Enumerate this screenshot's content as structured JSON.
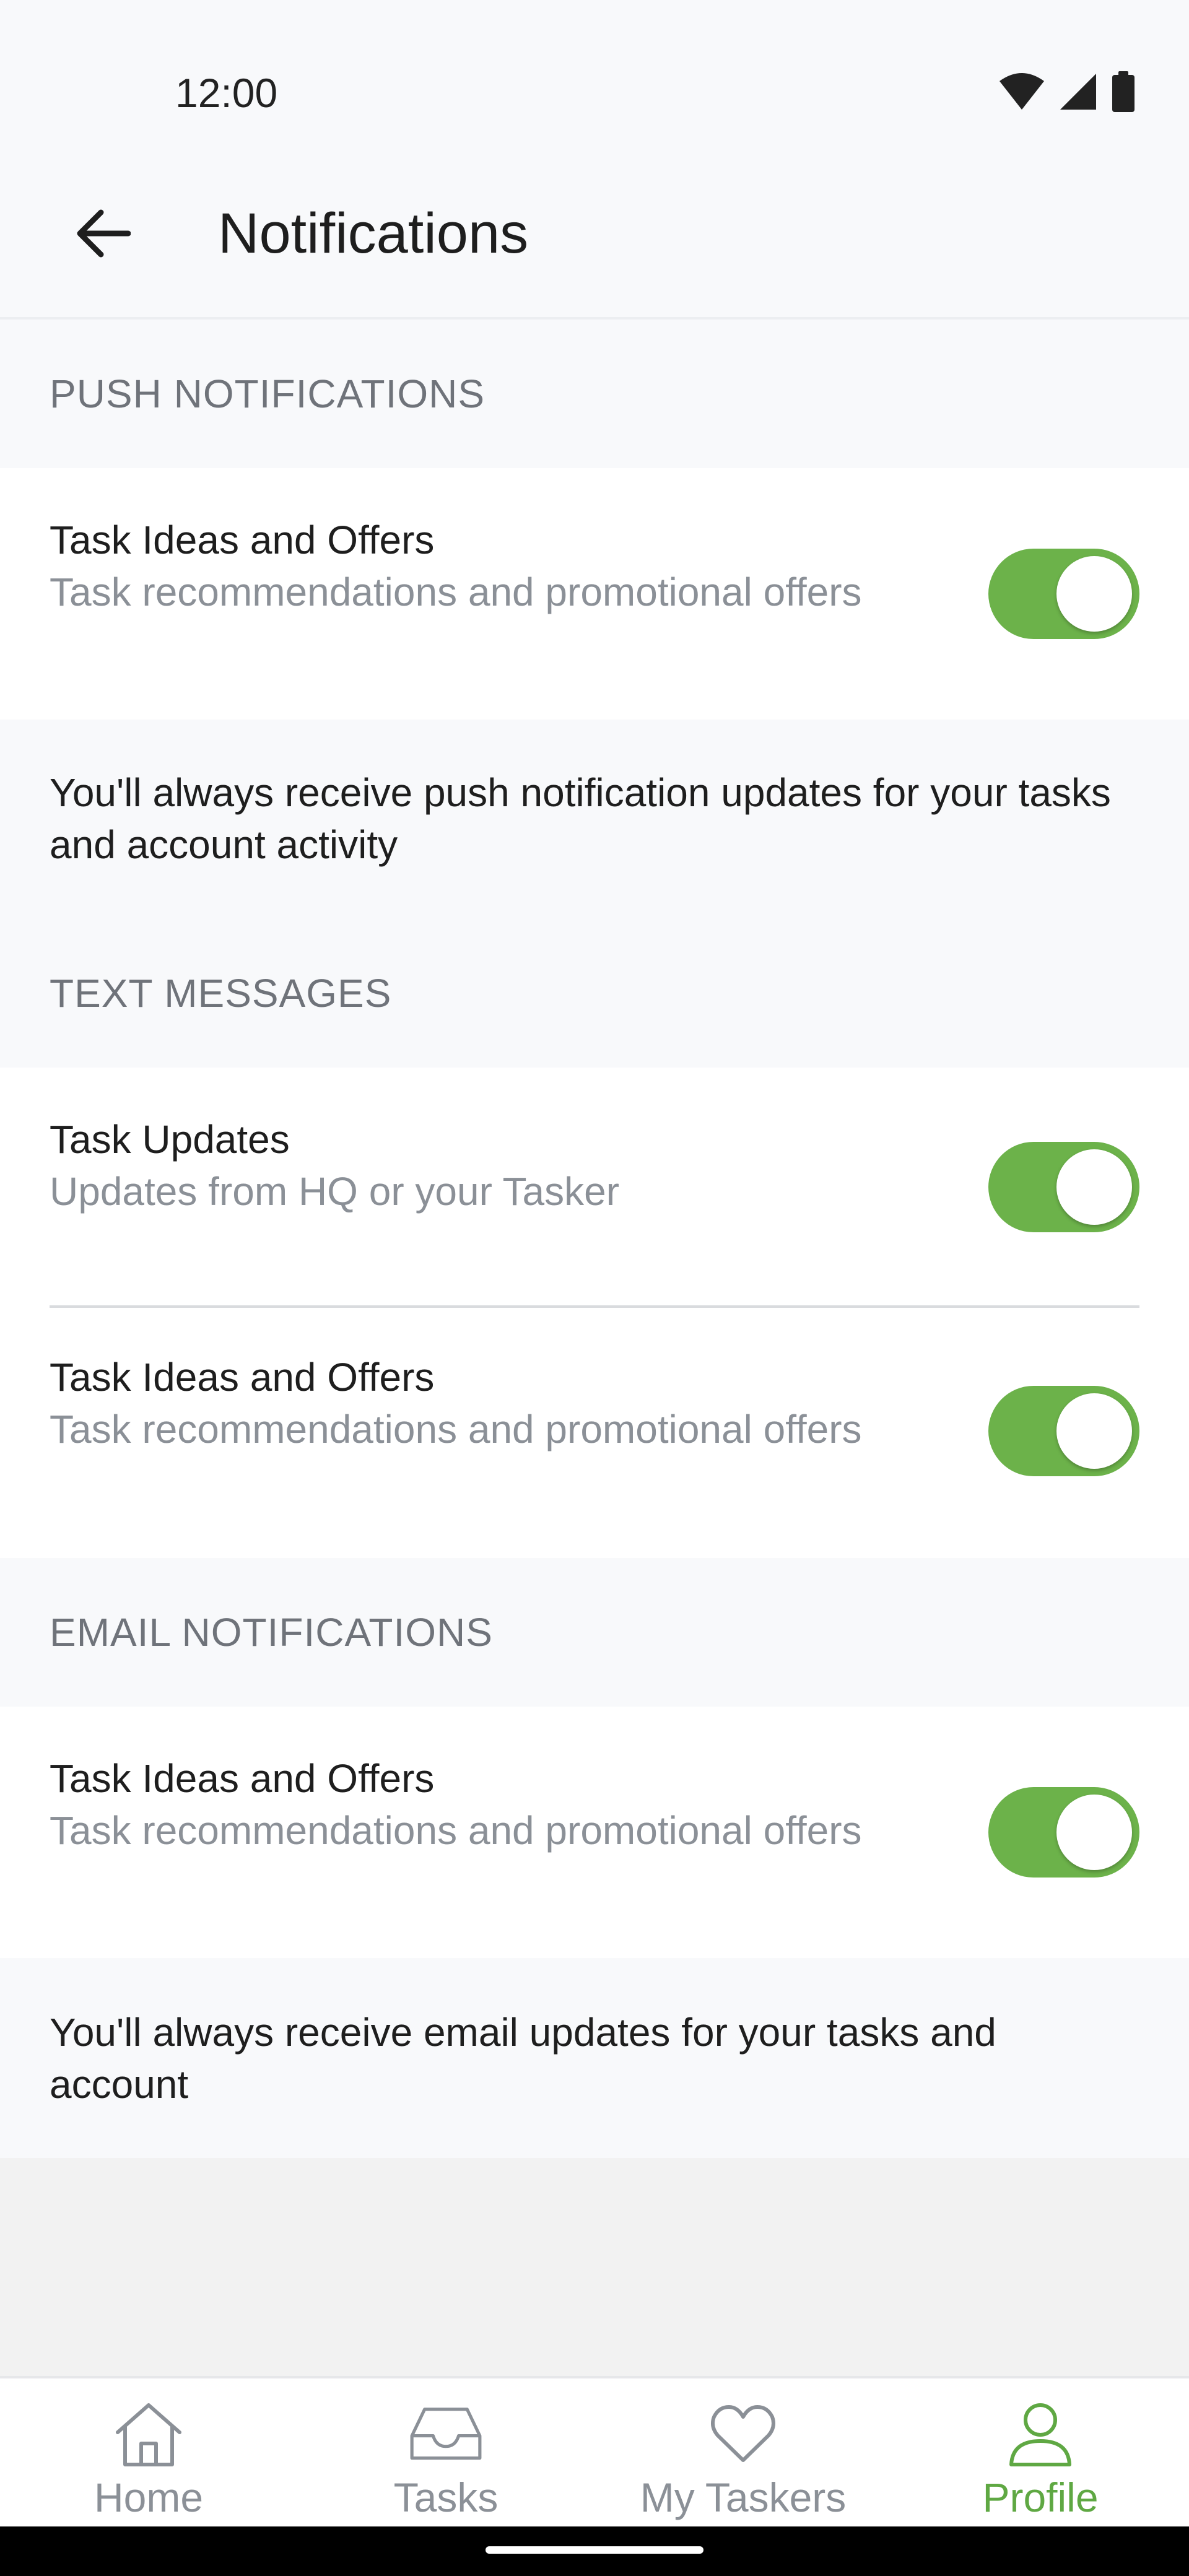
{
  "status_bar": {
    "time": "12:00"
  },
  "header": {
    "title": "Notifications"
  },
  "sections": {
    "push": {
      "title": "PUSH NOTIFICATIONS",
      "items": [
        {
          "title": "Task Ideas and Offers",
          "subtitle": "Task recommendations and promotional offers",
          "enabled": true
        }
      ],
      "info": "You'll always receive push notification updates for your tasks and account activity"
    },
    "text": {
      "title": "TEXT MESSAGES",
      "items": [
        {
          "title": "Task Updates",
          "subtitle": "Updates from HQ or your Tasker",
          "enabled": true
        },
        {
          "title": "Task Ideas and Offers",
          "subtitle": "Task recommendations and promotional offers",
          "enabled": true
        }
      ]
    },
    "email": {
      "title": "EMAIL NOTIFICATIONS",
      "items": [
        {
          "title": "Task Ideas and Offers",
          "subtitle": "Task recommendations and promotional offers",
          "enabled": true
        }
      ],
      "info": "You'll always receive email updates for your tasks and account"
    }
  },
  "bottom_nav": {
    "items": [
      {
        "label": "Home",
        "icon": "home-icon"
      },
      {
        "label": "Tasks",
        "icon": "inbox-tray-icon"
      },
      {
        "label": "My Taskers",
        "icon": "heart-icon"
      },
      {
        "label": "Profile",
        "icon": "person-icon",
        "active": true
      }
    ]
  },
  "colors": {
    "accent_green": "#6cb24a",
    "active_nav_green": "#5fa843",
    "muted_text": "#8b9097",
    "section_header_text": "#6f737a",
    "background": "#f8f9fb"
  }
}
